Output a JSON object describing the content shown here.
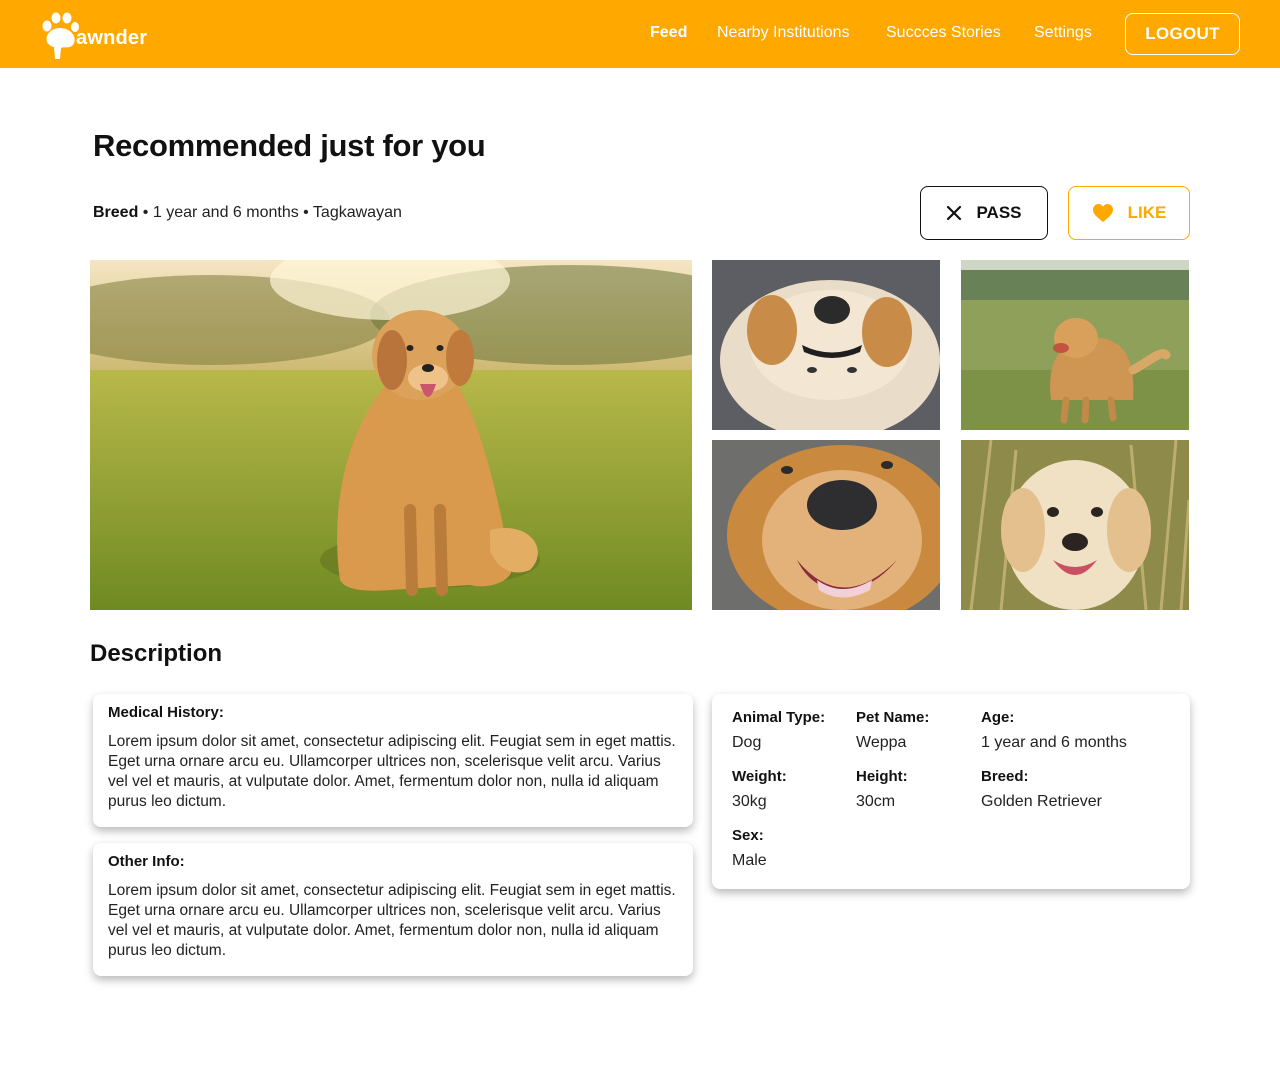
{
  "app": {
    "logo_text": "awnder",
    "brand_color": "#FFA800"
  },
  "nav": {
    "items": [
      {
        "label": "Feed",
        "active": true
      },
      {
        "label": "Nearby Institutions",
        "active": false
      },
      {
        "label": "Succces Stories",
        "active": false
      },
      {
        "label": "Settings",
        "active": false
      }
    ],
    "logout_label": "LOGOUT"
  },
  "main": {
    "title": "Recommended just for you",
    "meta": {
      "breed": "Breed",
      "details": " • 1 year and 6 months • Tagkawayan"
    },
    "actions": {
      "pass_label": "PASS",
      "pass_icon": "close-icon",
      "like_label": "LIKE",
      "like_icon": "heart-icon"
    }
  },
  "description": {
    "title": "Description",
    "medical": {
      "heading": "Medical History:",
      "text": "Lorem ipsum dolor sit amet, consectetur adipiscing elit. Feugiat sem in eget mattis. Eget urna ornare arcu eu. Ullamcorper ultrices non, scelerisque velit arcu. Varius vel vel et mauris, at vulputate dolor. Amet, fermentum dolor non, nulla id aliquam purus leo dictum."
    },
    "other": {
      "heading": "Other Info:",
      "text": "Lorem ipsum dolor sit amet, consectetur adipiscing elit. Feugiat sem in eget mattis. Eget urna ornare arcu eu. Ullamcorper ultrices non, scelerisque velit arcu. Varius vel vel et mauris, at vulputate dolor. Amet, fermentum dolor non, nulla id aliquam purus leo dictum."
    },
    "info": {
      "animal_type": {
        "label": "Animal Type:",
        "value": "Dog"
      },
      "pet_name": {
        "label": "Pet Name:",
        "value": "Weppa"
      },
      "age": {
        "label": "Age:",
        "value": "1 year and 6 months"
      },
      "weight": {
        "label": "Weight:",
        "value": "30kg"
      },
      "height": {
        "label": "Height:",
        "value": "30cm"
      },
      "breed": {
        "label": "Breed:",
        "value": "Golden Retriever"
      },
      "sex": {
        "label": "Sex:",
        "value": "Male"
      }
    }
  }
}
